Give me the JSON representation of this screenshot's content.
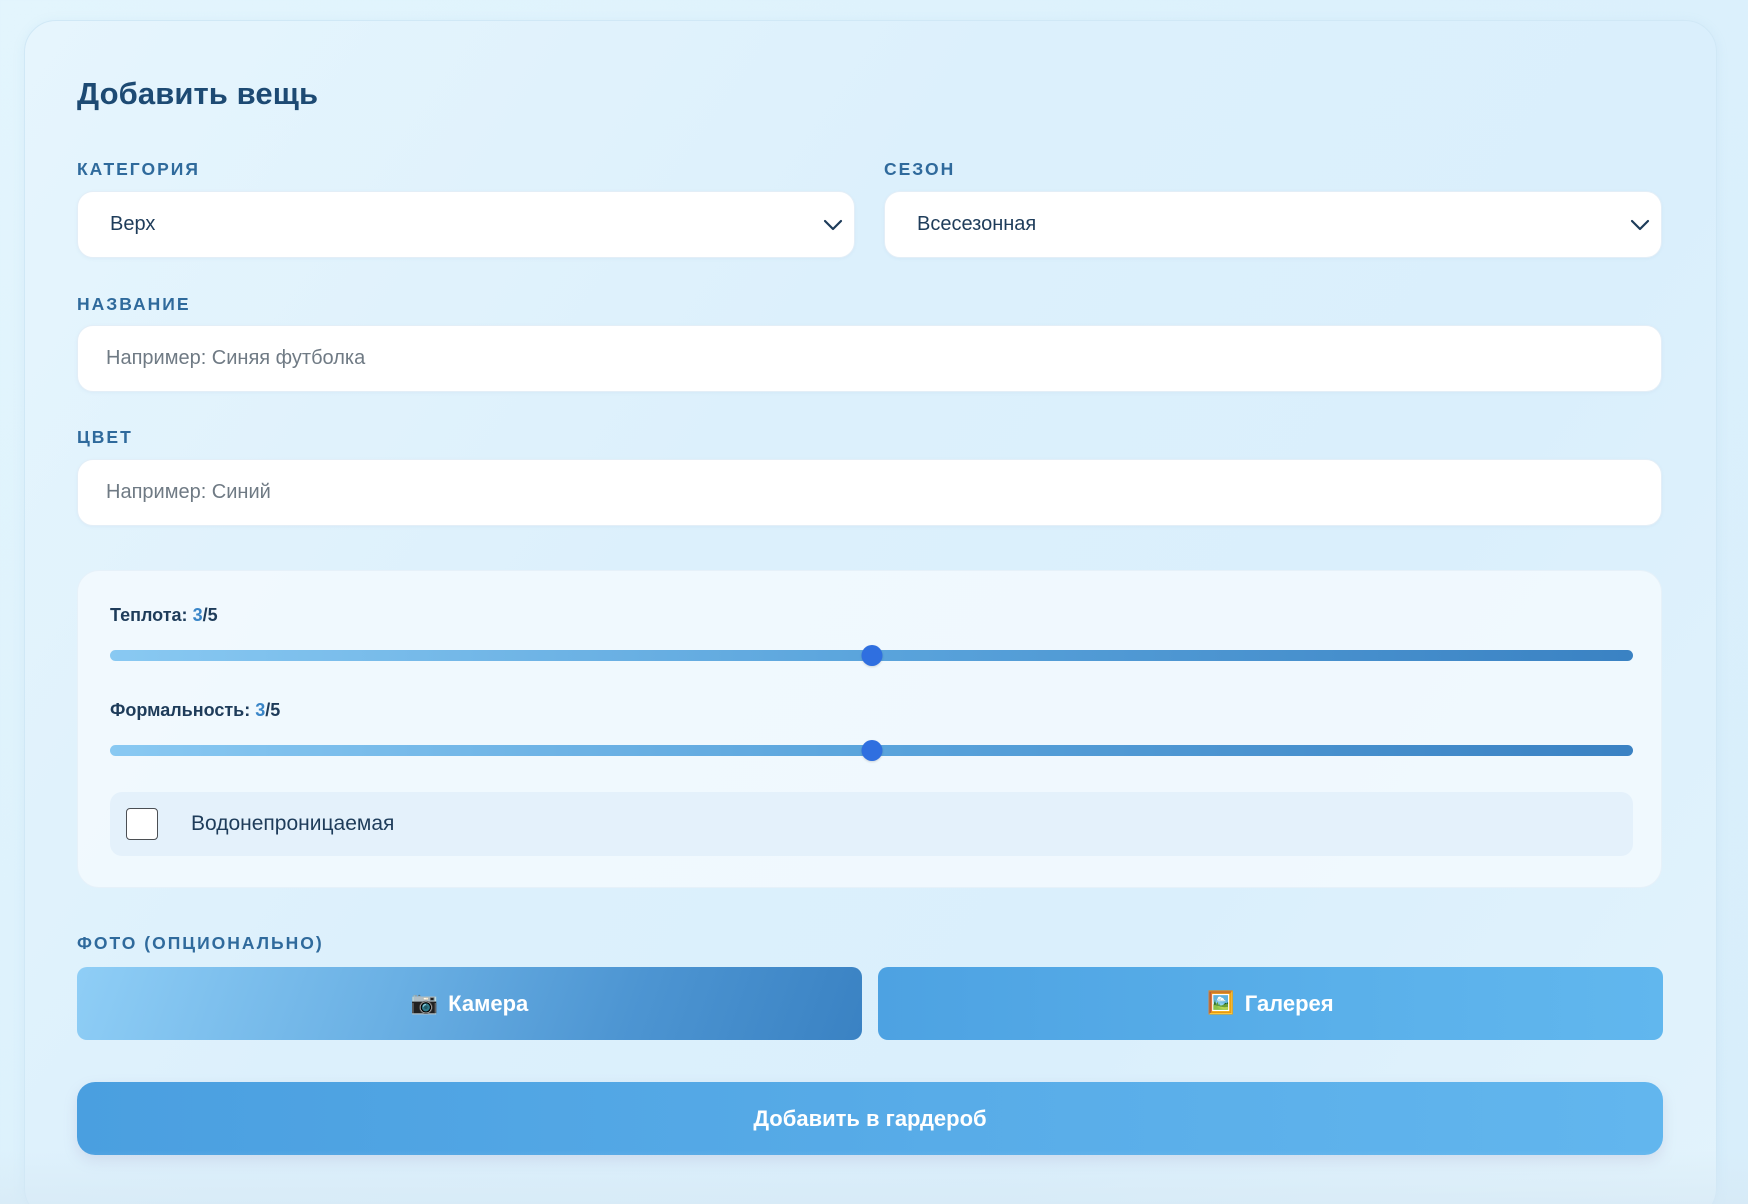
{
  "form": {
    "title": "Добавить вещь",
    "category": {
      "label": "Категория",
      "selected": "Верх"
    },
    "season": {
      "label": "Сезон",
      "selected": "Всесезонная"
    },
    "name": {
      "label": "Название",
      "value": "",
      "placeholder": "Например: Синяя футболка"
    },
    "color": {
      "label": "Цвет",
      "value": "",
      "placeholder": "Например: Синий"
    },
    "warmth": {
      "label": "Теплота:",
      "value": "3",
      "max": "/5"
    },
    "formality": {
      "label": "Формальность:",
      "value": "3",
      "max": "/5"
    },
    "waterproof": {
      "label": "Водонепроницаемая",
      "checked": false
    },
    "photo": {
      "label": "Фото (опционально)",
      "camera_label": "Камера",
      "camera_emoji": "📷",
      "gallery_label": "Галерея",
      "gallery_emoji": "🖼️"
    },
    "submit_label": "Добавить в гардероб"
  },
  "colors": {
    "title": "#1d4a73",
    "label": "#2f6a9c",
    "accent": "#2f6fe0",
    "button": "#4da2e2"
  }
}
